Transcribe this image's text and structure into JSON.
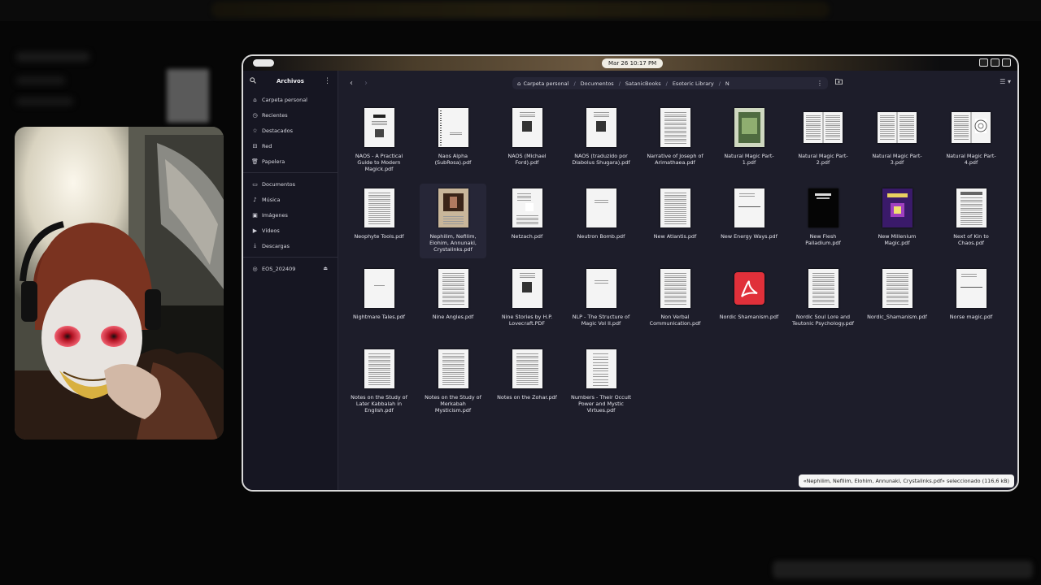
{
  "topbar": {
    "clock": "Mar 26  10:17 PM"
  },
  "sidebar": {
    "title": "Archivos",
    "places": [
      {
        "label": "Carpeta personal",
        "icon": "home-icon"
      },
      {
        "label": "Recientes",
        "icon": "clock-icon"
      },
      {
        "label": "Destacados",
        "icon": "star-icon"
      },
      {
        "label": "Red",
        "icon": "network-icon"
      },
      {
        "label": "Papelera",
        "icon": "trash-icon"
      }
    ],
    "folders": [
      {
        "label": "Documentos",
        "icon": "document-icon"
      },
      {
        "label": "Música",
        "icon": "music-icon"
      },
      {
        "label": "Imágenes",
        "icon": "image-icon"
      },
      {
        "label": "Vídeos",
        "icon": "video-icon"
      },
      {
        "label": "Descargas",
        "icon": "download-icon"
      }
    ],
    "drives": [
      {
        "label": "EOS_202409",
        "icon": "disc-icon"
      }
    ]
  },
  "breadcrumb": {
    "items": [
      "Carpeta personal",
      "Documentos",
      "SatanicBooks",
      "Esoteric Library",
      "N"
    ]
  },
  "files": [
    {
      "name": "NAOS - A Practical Guide to Modern Magick.pdf",
      "thumb": "doc-title"
    },
    {
      "name": "Naos Alpha (SubRosa).pdf",
      "thumb": "blank-spiral"
    },
    {
      "name": "NAOS (Michael Ford).pdf",
      "thumb": "doc-image"
    },
    {
      "name": "NAOS (traduzido por Diabolus Shugara).pdf",
      "thumb": "doc-image"
    },
    {
      "name": "Narrative of Joseph of Arimathaea.pdf",
      "thumb": "text"
    },
    {
      "name": "Natural Magic Part-1.pdf",
      "thumb": "green-cover"
    },
    {
      "name": "Natural Magic Part-2.pdf",
      "thumb": "spread"
    },
    {
      "name": "Natural Magic Part-3.pdf",
      "thumb": "spread"
    },
    {
      "name": "Natural Magic Part-4.pdf",
      "thumb": "spread-illus"
    },
    {
      "name": "Neophyte Tools.pdf",
      "thumb": "text"
    },
    {
      "name": "Nephilim, Nefilim, Elohim, Annunaki, Crystalinks.pdf",
      "thumb": "photo"
    },
    {
      "name": "Netzach.pdf",
      "thumb": "diagram"
    },
    {
      "name": "Neutron Bomb.pdf",
      "thumb": "title-only"
    },
    {
      "name": "New Atlantis.pdf",
      "thumb": "text"
    },
    {
      "name": "New Energy Ways.pdf",
      "thumb": "sparse"
    },
    {
      "name": "New Flesh Palladium.pdf",
      "thumb": "black-cover"
    },
    {
      "name": "New Millenium Magic.pdf",
      "thumb": "purple-cover"
    },
    {
      "name": "Next of Kin to Chaos.pdf",
      "thumb": "header-text"
    },
    {
      "name": "Nightmare Tales.pdf",
      "thumb": "blank"
    },
    {
      "name": "Nine Angles.pdf",
      "thumb": "text"
    },
    {
      "name": "Nine Stories by H.P. Lovecraft.PDF",
      "thumb": "doc-image"
    },
    {
      "name": "NLP - The Structure of Magic Vol II.pdf",
      "thumb": "title-only"
    },
    {
      "name": "Non Verbal Communication.pdf",
      "thumb": "text"
    },
    {
      "name": "Nordic Shamanism.pdf",
      "thumb": "pdf-icon"
    },
    {
      "name": "Nordic Soul Lore and Teutonic Psychology.pdf",
      "thumb": "text"
    },
    {
      "name": "Nordic_Shamanism.pdf",
      "thumb": "text"
    },
    {
      "name": "Norse magic.pdf",
      "thumb": "sparse"
    },
    {
      "name": "Notes on the Study of Later Kabbalah in English.pdf",
      "thumb": "text"
    },
    {
      "name": "Notes on the Study of Merkabah Mysticism.pdf",
      "thumb": "text"
    },
    {
      "name": "Notes on the Zohar.pdf",
      "thumb": "text"
    },
    {
      "name": "Numbers - Their Occult Power and Mystic Virtues.pdf",
      "thumb": "list"
    }
  ],
  "selected_index": 10,
  "status": "«Nephilim, Nefilim, Elohim, Annunaki, Crystalinks.pdf» seleccionado  (116,6 kB)"
}
